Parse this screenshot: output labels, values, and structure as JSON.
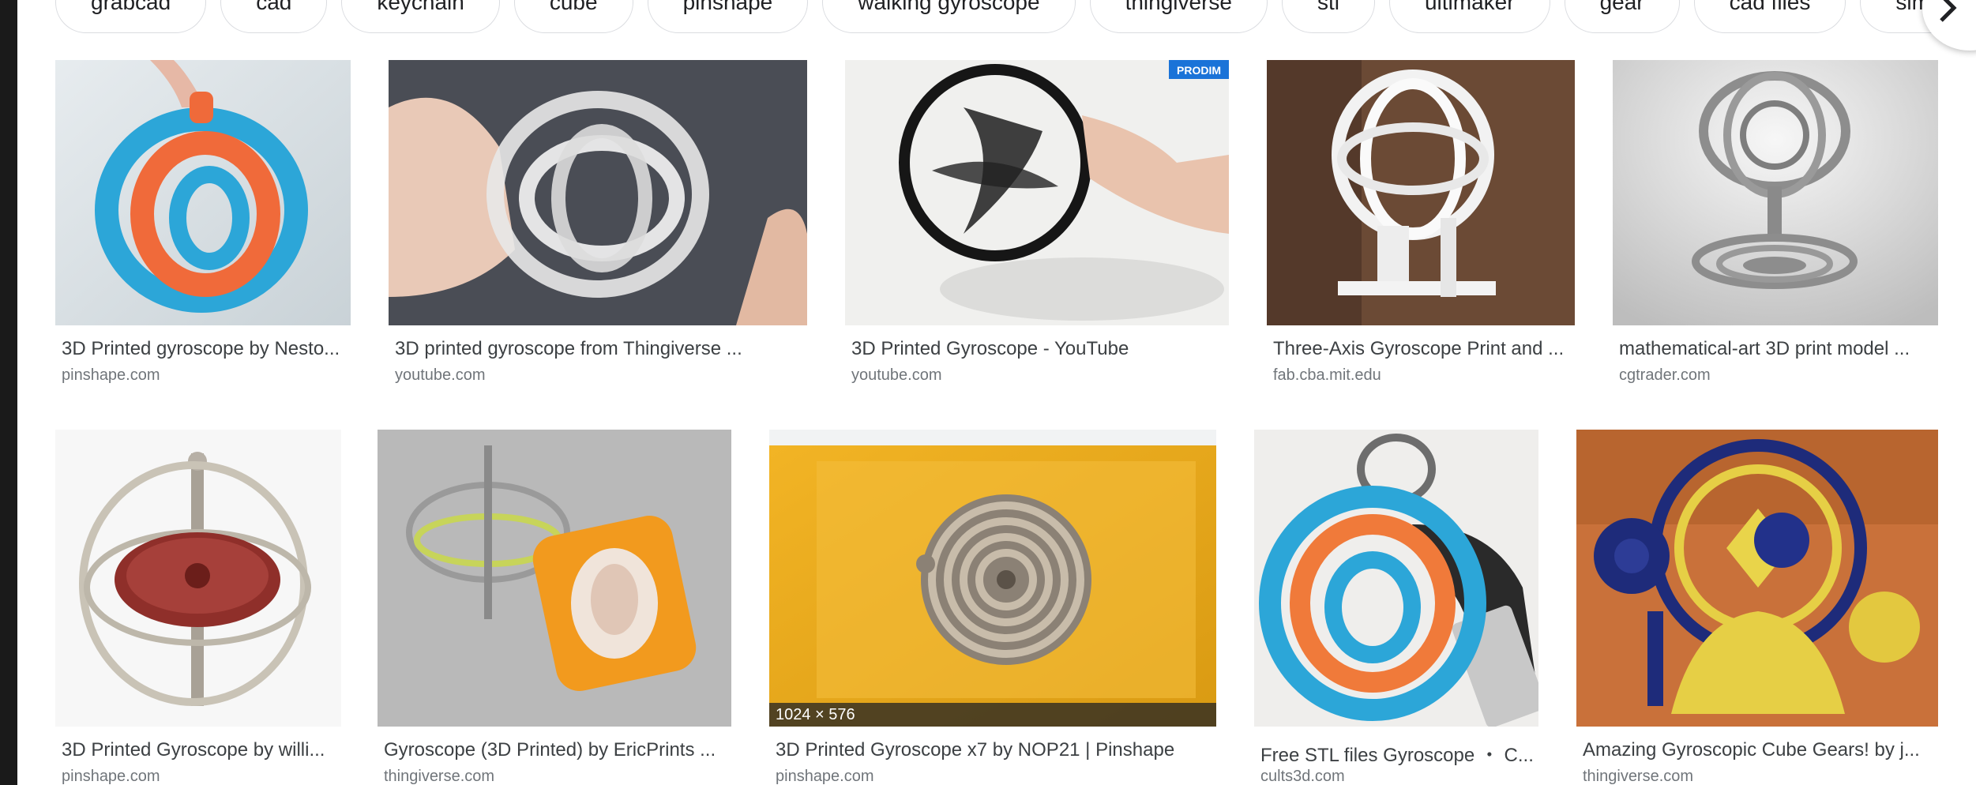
{
  "chips": [
    "grabcad",
    "cad",
    "keychain",
    "cube",
    "pinshape",
    "walking gyroscope",
    "thingiverse",
    "stl",
    "ultimaker",
    "gear",
    "cad files",
    "simple gy"
  ],
  "results_row1": [
    {
      "caption": "3D Printed gyroscope by Nesto...",
      "source": "pinshape.com"
    },
    {
      "caption": "3D printed gyroscope from Thingiverse ...",
      "source": "youtube.com",
      "watermark": "PRODIM"
    },
    {
      "caption": "3D Printed Gyroscope - YouTube",
      "source": "youtube.com"
    },
    {
      "caption": "Three-Axis Gyroscope Print and ...",
      "source": "fab.cba.mit.edu"
    },
    {
      "caption": "mathematical-art 3D print model ...",
      "source": "cgtrader.com"
    }
  ],
  "results_row2": [
    {
      "caption": "3D Printed Gyroscope by willi...",
      "source": "pinshape.com"
    },
    {
      "caption": "Gyroscope (3D Printed) by EricPrints ...",
      "source": "thingiverse.com"
    },
    {
      "caption": "3D Printed Gyroscope x7 by NOP21 | Pinshape",
      "source": "pinshape.com",
      "dimensions": "1024 × 576"
    },
    {
      "caption": "Free STL files Gyroscope ・ C...",
      "source": "cults3d.com"
    },
    {
      "caption": "Amazing Gyroscopic Cube Gears! by j...",
      "source": "thingiverse.com"
    }
  ]
}
